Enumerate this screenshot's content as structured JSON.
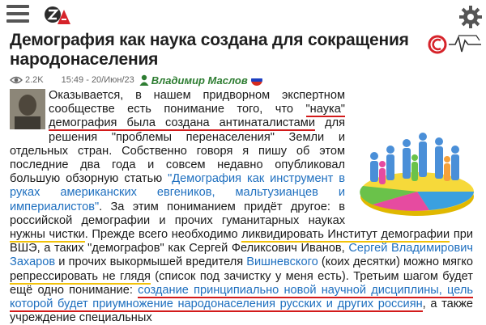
{
  "header": {
    "logo_text": "ZA",
    "menu_icon": "hamburger-menu-icon",
    "settings_icon": "gear-icon"
  },
  "article": {
    "title": "Демография как наука создана для сокращения народонаселения",
    "views": "2.2K",
    "datetime": "15:49 - 20/Июн/23",
    "author": "Владимир Маслов",
    "paragraph": {
      "p1": "Оказывается, в нашем придворном экспертном сообществе есть понимание того, что ",
      "u1": "\"наука\" демография была создана антинаталистами",
      "p2": " для решения \"проблемы перенаселения\" Земли и отдельных стран. Собственно говоря я пишу об этом последние два года и совсем недавно опубликовал большую обзорную статью ",
      "link1": "\"Демография как инструмент в руках американских евгеников, мальтузианцев и империалистов\"",
      "p3": ". За этим пониманием придёт другое: в российской демографии и прочих гуманитарных науках ",
      "u2a": "нужны чистки",
      "p4": ". Прежде всего необходимо ",
      "u2b": "ликвидировать Институт демографии",
      "p5": " при ВШЭ, а таких \"демографов\" как Сергей Феликсович Иванов, ",
      "link2": "Сергей Владимирович Захаров",
      "p6": " и прочих выкормышей вредителя ",
      "link3": "Вишневского",
      "p7": " (коих десятки) можно мягко ",
      "u3": "репрессировать не глядя",
      "p8": " (список под зачистку у меня есть). Третьим шагом будет ещё одно понимание: ",
      "link4": "создание принципиально новой научной дисциплины, цель которой будет приумножение народонаселения русских и других россиян",
      "p9": ", а также учреждение специальных"
    }
  },
  "colors": {
    "author": "#2e7d32",
    "link": "#1e6fbf",
    "underline_red": "#d21a1a",
    "underline_yellow": "#f2c20a",
    "logo_red": "#d6232a"
  }
}
